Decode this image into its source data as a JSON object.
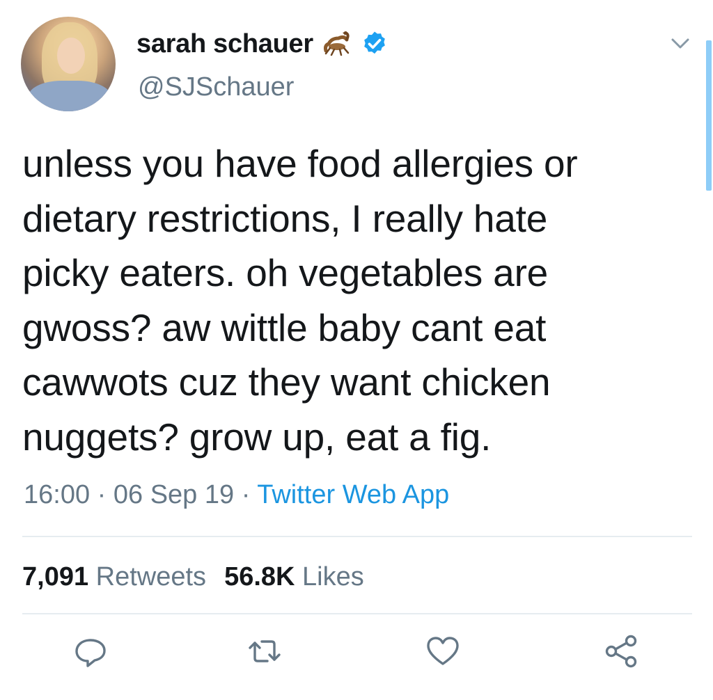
{
  "user": {
    "display_name": "sarah schauer",
    "handle": "@SJSchauer",
    "emoji_icon": "scorpion-icon",
    "verified": true
  },
  "tweet": {
    "text": "unless you have food allergies or\ndietary restrictions, I really hate\npicky eaters. oh vegetables are\ngwoss? aw wittle baby cant eat\ncawwots cuz they want chicken\nnuggets? grow up, eat a fig.",
    "time": "16:00",
    "separator": " · ",
    "date": "06 Sep 19",
    "source": "Twitter Web App"
  },
  "stats": {
    "retweets_count": "7,091",
    "retweets_label": "Retweets",
    "likes_count": "56.8K",
    "likes_label": "Likes"
  },
  "actions": [
    "reply-icon",
    "retweet-icon",
    "like-icon",
    "share-icon"
  ],
  "colors": {
    "text": "#14171a",
    "secondary": "#657786",
    "accent": "#1b95e0",
    "verified": "#1da1f2",
    "divider": "#e6ecf0"
  }
}
